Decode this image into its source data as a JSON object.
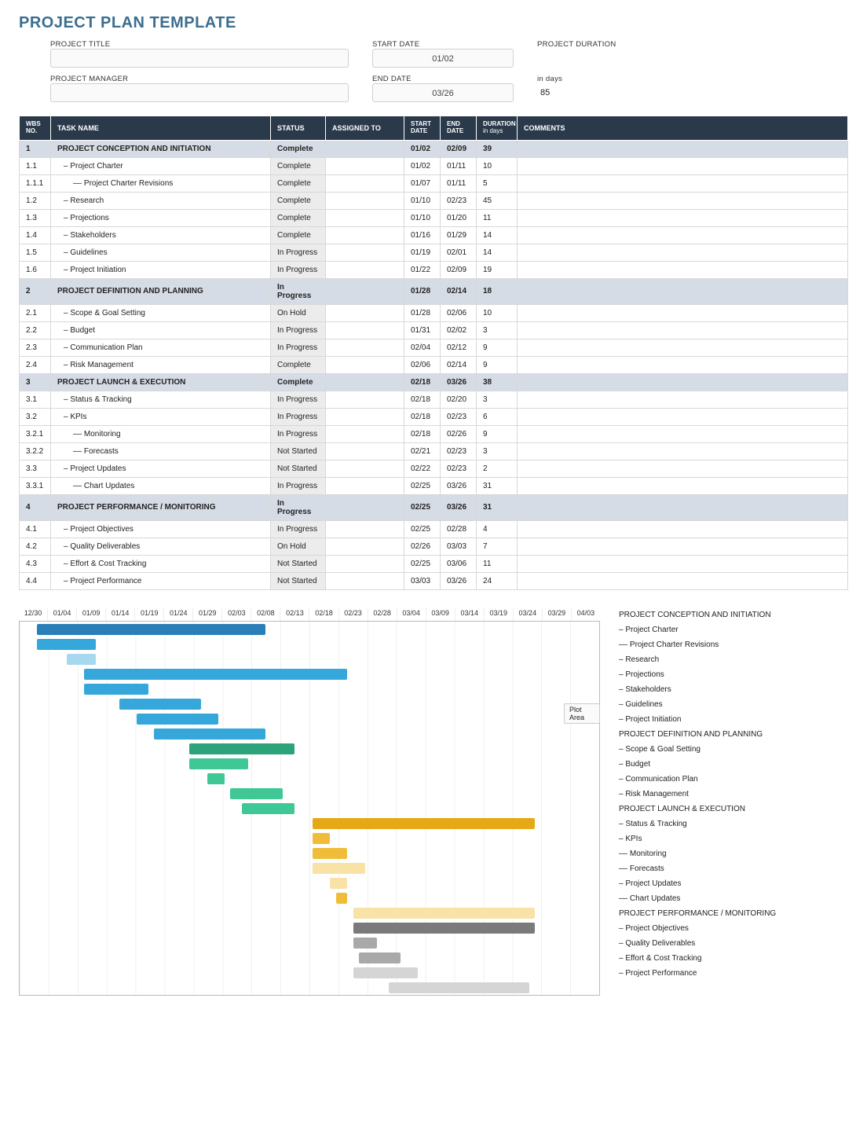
{
  "title": "PROJECT PLAN TEMPLATE",
  "meta": {
    "project_title_label": "PROJECT TITLE",
    "project_title_value": "",
    "project_manager_label": "PROJECT MANAGER",
    "project_manager_value": "",
    "start_date_label": "START DATE",
    "start_date_value": "01/02",
    "end_date_label": "END DATE",
    "end_date_value": "03/26",
    "duration_label": "PROJECT DURATION",
    "duration_unit": "in days",
    "duration_value": "85"
  },
  "columns": {
    "wbs": "WBS NO.",
    "task": "TASK NAME",
    "status": "STATUS",
    "assigned": "ASSIGNED TO",
    "start": "START DATE",
    "end": "END DATE",
    "duration": "DURATION",
    "duration_sub": "in days",
    "comments": "COMMENTS"
  },
  "rows": [
    {
      "wbs": "1",
      "task": "PROJECT CONCEPTION AND INITIATION",
      "status": "Complete",
      "start": "01/02",
      "end": "02/09",
      "dur": "39",
      "section": true
    },
    {
      "wbs": "1.1",
      "task": "– Project Charter",
      "status": "Complete",
      "start": "01/02",
      "end": "01/11",
      "dur": "10",
      "indent": 1
    },
    {
      "wbs": "1.1.1",
      "task": "–– Project Charter Revisions",
      "status": "Complete",
      "start": "01/07",
      "end": "01/11",
      "dur": "5",
      "indent": 2
    },
    {
      "wbs": "1.2",
      "task": "– Research",
      "status": "Complete",
      "start": "01/10",
      "end": "02/23",
      "dur": "45",
      "indent": 1
    },
    {
      "wbs": "1.3",
      "task": "– Projections",
      "status": "Complete",
      "start": "01/10",
      "end": "01/20",
      "dur": "11",
      "indent": 1
    },
    {
      "wbs": "1.4",
      "task": "– Stakeholders",
      "status": "Complete",
      "start": "01/16",
      "end": "01/29",
      "dur": "14",
      "indent": 1
    },
    {
      "wbs": "1.5",
      "task": "– Guidelines",
      "status": "In Progress",
      "start": "01/19",
      "end": "02/01",
      "dur": "14",
      "indent": 1
    },
    {
      "wbs": "1.6",
      "task": "– Project Initiation",
      "status": "In Progress",
      "start": "01/22",
      "end": "02/09",
      "dur": "19",
      "indent": 1
    },
    {
      "wbs": "2",
      "task": "PROJECT DEFINITION AND PLANNING",
      "status": "In Progress",
      "start": "01/28",
      "end": "02/14",
      "dur": "18",
      "section": true
    },
    {
      "wbs": "2.1",
      "task": "– Scope & Goal Setting",
      "status": "On Hold",
      "start": "01/28",
      "end": "02/06",
      "dur": "10",
      "indent": 1
    },
    {
      "wbs": "2.2",
      "task": "– Budget",
      "status": "In Progress",
      "start": "01/31",
      "end": "02/02",
      "dur": "3",
      "indent": 1
    },
    {
      "wbs": "2.3",
      "task": "– Communication Plan",
      "status": "In Progress",
      "start": "02/04",
      "end": "02/12",
      "dur": "9",
      "indent": 1
    },
    {
      "wbs": "2.4",
      "task": "– Risk Management",
      "status": "Complete",
      "start": "02/06",
      "end": "02/14",
      "dur": "9",
      "indent": 1
    },
    {
      "wbs": "3",
      "task": "PROJECT LAUNCH & EXECUTION",
      "status": "Complete",
      "start": "02/18",
      "end": "03/26",
      "dur": "38",
      "section": true
    },
    {
      "wbs": "3.1",
      "task": "– Status & Tracking",
      "status": "In Progress",
      "start": "02/18",
      "end": "02/20",
      "dur": "3",
      "indent": 1
    },
    {
      "wbs": "3.2",
      "task": "– KPIs",
      "status": "In Progress",
      "start": "02/18",
      "end": "02/23",
      "dur": "6",
      "indent": 1
    },
    {
      "wbs": "3.2.1",
      "task": "–– Monitoring",
      "status": "In Progress",
      "start": "02/18",
      "end": "02/26",
      "dur": "9",
      "indent": 2
    },
    {
      "wbs": "3.2.2",
      "task": "–– Forecasts",
      "status": "Not Started",
      "start": "02/21",
      "end": "02/23",
      "dur": "3",
      "indent": 2
    },
    {
      "wbs": "3.3",
      "task": "– Project Updates",
      "status": "Not Started",
      "start": "02/22",
      "end": "02/23",
      "dur": "2",
      "indent": 1
    },
    {
      "wbs": "3.3.1",
      "task": "–– Chart Updates",
      "status": "In Progress",
      "start": "02/25",
      "end": "03/26",
      "dur": "31",
      "indent": 2
    },
    {
      "wbs": "4",
      "task": "PROJECT PERFORMANCE / MONITORING",
      "status": "In Progress",
      "start": "02/25",
      "end": "03/26",
      "dur": "31",
      "section": true
    },
    {
      "wbs": "4.1",
      "task": "– Project Objectives",
      "status": "In Progress",
      "start": "02/25",
      "end": "02/28",
      "dur": "4",
      "indent": 1
    },
    {
      "wbs": "4.2",
      "task": "– Quality Deliverables",
      "status": "On Hold",
      "start": "02/26",
      "end": "03/03",
      "dur": "7",
      "indent": 1
    },
    {
      "wbs": "4.3",
      "task": "– Effort & Cost Tracking",
      "status": "Not Started",
      "start": "02/25",
      "end": "03/06",
      "dur": "11",
      "indent": 1
    },
    {
      "wbs": "4.4",
      "task": "– Project Performance",
      "status": "Not Started",
      "start": "03/03",
      "end": "03/26",
      "dur": "24",
      "indent": 1
    }
  ],
  "chart_data": {
    "type": "bar",
    "orientation": "horizontal-gantt",
    "x_start": "12/30",
    "x_end": "04/07",
    "x_ticks": [
      "12/30",
      "01/04",
      "01/09",
      "01/14",
      "01/19",
      "01/24",
      "01/29",
      "02/03",
      "02/08",
      "02/13",
      "02/18",
      "02/23",
      "02/28",
      "03/04",
      "03/09",
      "03/14",
      "03/19",
      "03/24",
      "03/29",
      "04/03"
    ],
    "total_days": 99,
    "colors": {
      "section1": "#2a7fb8",
      "section1_sub": "#35a7db",
      "section1_sub_light": "#a8d8ef",
      "section2": "#2da37a",
      "section2_sub": "#3fc895",
      "section3": "#e6a817",
      "section3_sub": "#f0bd3a",
      "section3_sub_light": "#f8e2a6",
      "section4": "#7a7a7a",
      "section4_sub": "#a9a9a9",
      "section4_sub_light": "#d5d5d5"
    },
    "series": [
      {
        "name": "PROJECT CONCEPTION AND INITIATION",
        "start_offset": 3,
        "duration": 39,
        "color": "section1"
      },
      {
        "name": "– Project Charter",
        "start_offset": 3,
        "duration": 10,
        "color": "section1_sub"
      },
      {
        "name": "–– Project Charter Revisions",
        "start_offset": 8,
        "duration": 5,
        "color": "section1_sub_light"
      },
      {
        "name": "– Research",
        "start_offset": 11,
        "duration": 45,
        "color": "section1_sub"
      },
      {
        "name": "– Projections",
        "start_offset": 11,
        "duration": 11,
        "color": "section1_sub"
      },
      {
        "name": "– Stakeholders",
        "start_offset": 17,
        "duration": 14,
        "color": "section1_sub"
      },
      {
        "name": "– Guidelines",
        "start_offset": 20,
        "duration": 14,
        "color": "section1_sub"
      },
      {
        "name": "– Project Initiation",
        "start_offset": 23,
        "duration": 19,
        "color": "section1_sub"
      },
      {
        "name": "PROJECT DEFINITION AND PLANNING",
        "start_offset": 29,
        "duration": 18,
        "color": "section2"
      },
      {
        "name": "– Scope & Goal Setting",
        "start_offset": 29,
        "duration": 10,
        "color": "section2_sub"
      },
      {
        "name": "– Budget",
        "start_offset": 32,
        "duration": 3,
        "color": "section2_sub"
      },
      {
        "name": "– Communication Plan",
        "start_offset": 36,
        "duration": 9,
        "color": "section2_sub"
      },
      {
        "name": "– Risk Management",
        "start_offset": 38,
        "duration": 9,
        "color": "section2_sub"
      },
      {
        "name": "PROJECT LAUNCH & EXECUTION",
        "start_offset": 50,
        "duration": 38,
        "color": "section3"
      },
      {
        "name": "– Status & Tracking",
        "start_offset": 50,
        "duration": 3,
        "color": "section3_sub"
      },
      {
        "name": "– KPIs",
        "start_offset": 50,
        "duration": 6,
        "color": "section3_sub"
      },
      {
        "name": "–– Monitoring",
        "start_offset": 50,
        "duration": 9,
        "color": "section3_sub_light"
      },
      {
        "name": "–– Forecasts",
        "start_offset": 53,
        "duration": 3,
        "color": "section3_sub_light"
      },
      {
        "name": "– Project Updates",
        "start_offset": 54,
        "duration": 2,
        "color": "section3_sub"
      },
      {
        "name": "–– Chart Updates",
        "start_offset": 57,
        "duration": 31,
        "color": "section3_sub_light"
      },
      {
        "name": "PROJECT PERFORMANCE / MONITORING",
        "start_offset": 57,
        "duration": 31,
        "color": "section4"
      },
      {
        "name": "– Project Objectives",
        "start_offset": 57,
        "duration": 4,
        "color": "section4_sub"
      },
      {
        "name": "– Quality Deliverables",
        "start_offset": 58,
        "duration": 7,
        "color": "section4_sub"
      },
      {
        "name": "– Effort & Cost Tracking",
        "start_offset": 57,
        "duration": 11,
        "color": "section4_sub_light"
      },
      {
        "name": "– Project Performance",
        "start_offset": 63,
        "duration": 24,
        "color": "section4_sub_light"
      }
    ],
    "plot_tip": "Plot Area"
  }
}
